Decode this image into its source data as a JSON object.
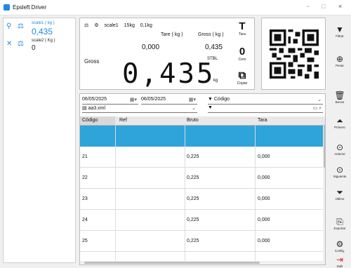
{
  "window": {
    "title": "Epsleft Driver",
    "minimize": "−",
    "maximize": "□",
    "close": "×"
  },
  "scales": [
    {
      "name": "scale1 ( kg )",
      "value": "0,435"
    },
    {
      "name": "scale2 ( Kg )",
      "value": "0"
    }
  ],
  "weight": {
    "header": [
      "scale1",
      "15kg",
      "0,1kg"
    ],
    "tare_label": "Tare ( kg )",
    "gross_label": "Gross ( kg )",
    "gross_side": "Gross",
    "tare_value": "0,000",
    "gross_value": "0,435",
    "stable": "STBL",
    "main_value": "0,435",
    "unit": "kg",
    "buttons": [
      {
        "label": "Tara",
        "icon": "T"
      },
      {
        "label": "Cero",
        "icon": "0"
      },
      {
        "label": "Copiar",
        "icon": "⧉"
      }
    ]
  },
  "toolbar": [
    {
      "label": "Filtrar",
      "icon": "funnel-icon"
    },
    {
      "label": "Pesar",
      "icon": "plus-circle-icon"
    },
    {
      "label": "Borrar",
      "icon": "trash-icon"
    },
    {
      "label": "Primero",
      "icon": "first-icon"
    },
    {
      "label": "Anterior",
      "icon": "up-circle-icon"
    },
    {
      "label": "Siguiente",
      "icon": "down-circle-icon"
    },
    {
      "label": "Último",
      "icon": "last-icon"
    },
    {
      "label": "Exportar",
      "icon": "export-icon"
    },
    {
      "label": "Config.",
      "icon": "gear-icon"
    },
    {
      "label": "Salir",
      "icon": "exit-icon"
    }
  ],
  "filters": {
    "date_from": "06/05/2025",
    "date_to": "06/05/2025",
    "file": "aa3.xml",
    "field": "Código",
    "search": ""
  },
  "table": {
    "columns": [
      "Código",
      "Ref",
      "Bruto",
      "Tara"
    ],
    "rows": [
      [
        "21",
        "",
        "0,225",
        "0,000"
      ],
      [
        "22",
        "",
        "0,225",
        "0,000"
      ],
      [
        "23",
        "",
        "0,225",
        "0,000"
      ],
      [
        "24",
        "",
        "0,225",
        "0,000"
      ],
      [
        "25",
        "",
        "0,225",
        "0,000"
      ]
    ]
  },
  "colors": {
    "accent": "#1e88e5",
    "selection": "#2ea4da"
  }
}
